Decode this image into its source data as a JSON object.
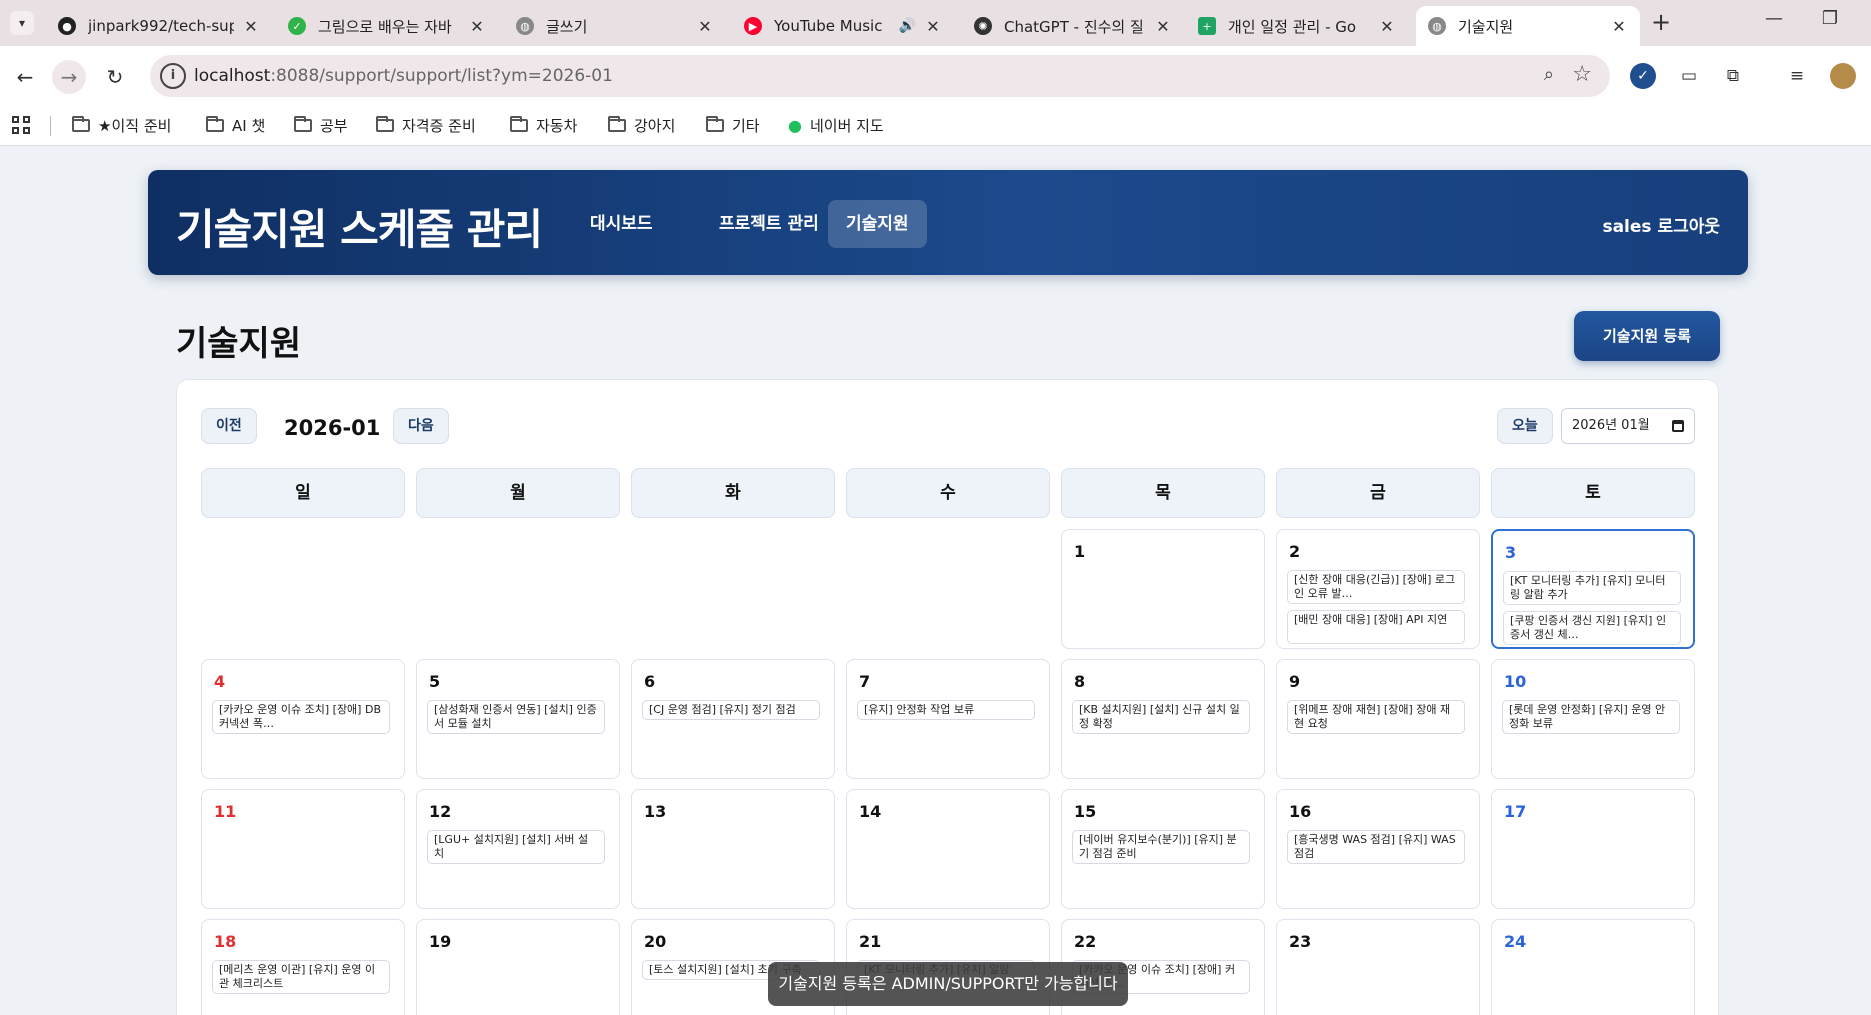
{
  "browser": {
    "tabs": [
      {
        "title": "jinpark992/tech-sup",
        "icon": "github-icon",
        "color": "#222222"
      },
      {
        "title": "그림으로 배우는 자바",
        "icon": "book-icon",
        "color": "#2fb34a"
      },
      {
        "title": "글쓰기",
        "icon": "globe-icon",
        "color": "#666666"
      },
      {
        "title": "YouTube Music",
        "icon": "youtube-music-icon",
        "color": "#ff0033"
      },
      {
        "title": "ChatGPT - 진수의 질",
        "icon": "chatgpt-icon",
        "color": "#333333"
      },
      {
        "title": "개인 일정 관리 - Go",
        "icon": "sheets-icon",
        "color": "#1fa463"
      },
      {
        "title": "기술지원",
        "icon": "globe-icon",
        "color": "#666666"
      }
    ],
    "url_host": "localhost",
    "url_rest": ":8088/support/support/list?ym=2026-01",
    "bookmarks": [
      "★이직 준비",
      "AI 챗",
      "공부",
      "자격증 준비",
      "자동차",
      "강아지",
      "기타",
      "네이버 지도"
    ]
  },
  "app": {
    "brand": "기술지원 스케줄 관리",
    "nav": [
      "대시보드",
      "프로젝트 관리",
      "기술지원"
    ],
    "logout": "sales 로그아웃",
    "page_title": "기술지원",
    "register_label": "기술지원 등록"
  },
  "calendar": {
    "prev_label": "이전",
    "next_label": "다음",
    "month": "2026-01",
    "today_label": "오늘",
    "month_input": "2026년 01월",
    "weekdays": [
      "일",
      "월",
      "화",
      "수",
      "목",
      "금",
      "토"
    ],
    "days": [
      {
        "num": "1",
        "events": []
      },
      {
        "num": "2",
        "events": [
          "[신한 장애 대응(긴급)] [장애] 로그인 오류 발…",
          "[배민 장애 대응] [장애] API 지연"
        ]
      },
      {
        "num": "3",
        "events": [
          "[KT 모니터링 추가] [유지] 모니터링 알람 추가",
          "[쿠팡 인증서 갱신 지원] [유지] 인증서 갱신 체…"
        ]
      },
      {
        "num": "4",
        "events": [
          "[카카오 운영 이슈 조치] [장애] DB 커넥션 폭…"
        ]
      },
      {
        "num": "5",
        "events": [
          "[삼성화재 인증서 연동] [설치] 인증서 모듈 설치"
        ]
      },
      {
        "num": "6",
        "events": [
          "[CJ 운영 점검] [유지] 정기 점검"
        ]
      },
      {
        "num": "7",
        "events": [
          "[유지] 안정화 작업 보류"
        ]
      },
      {
        "num": "8",
        "events": [
          "[KB 설치지원] [설치] 신규 설치 일정 확정"
        ]
      },
      {
        "num": "9",
        "events": [
          "[위메프 장애 재현] [장애] 장애 재현 요청"
        ]
      },
      {
        "num": "10",
        "events": [
          "[롯데 운영 안정화] [유지] 운영 안정화 보류"
        ]
      },
      {
        "num": "11",
        "events": []
      },
      {
        "num": "12",
        "events": [
          "[LGU+ 설치지원] [설치] 서버 설치"
        ]
      },
      {
        "num": "13",
        "events": []
      },
      {
        "num": "14",
        "events": []
      },
      {
        "num": "15",
        "events": [
          "[네이버 유지보수(분기)] [유지] 분기 점검 준비"
        ]
      },
      {
        "num": "16",
        "events": [
          "[흥국생명 WAS 점검] [유지] WAS 점검"
        ]
      },
      {
        "num": "17",
        "events": []
      },
      {
        "num": "18",
        "events": [
          "[메리츠 운영 이관] [유지] 운영 이관 체크리스트"
        ]
      },
      {
        "num": "19",
        "events": []
      },
      {
        "num": "20",
        "events": [
          "[토스 설치지원] [설치] 초기 구축"
        ]
      },
      {
        "num": "21",
        "events": [
          "[KT 모니터링 추가] [유지] 알람"
        ]
      },
      {
        "num": "22",
        "events": [
          "[카카오 운영 이슈 조치] [장애] 커넥션 조…"
        ]
      },
      {
        "num": "23",
        "events": []
      },
      {
        "num": "24",
        "events": []
      }
    ]
  },
  "toast": "기술지원 등록은 ADMIN/SUPPORT만 가능합니다"
}
